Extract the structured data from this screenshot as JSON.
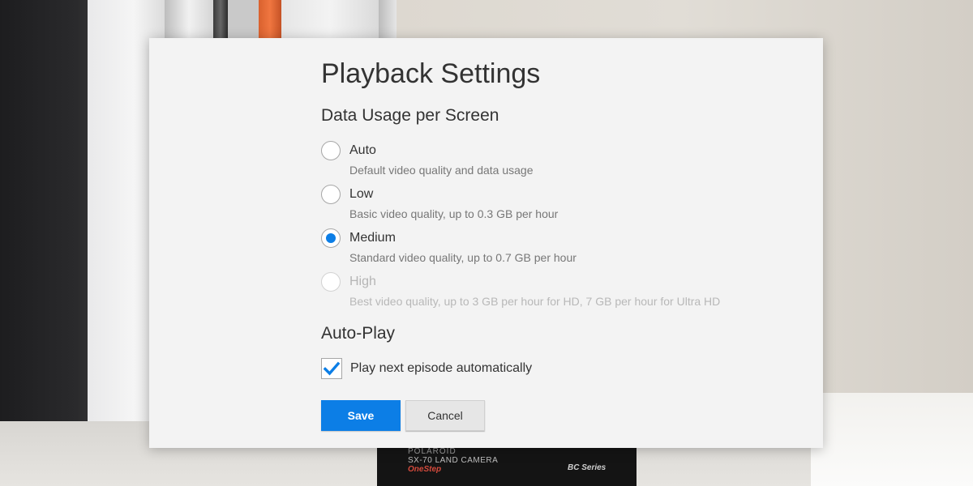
{
  "background": {
    "camera": {
      "line1": "POLAROID",
      "line2": "SX-70 LAND CAMERA",
      "line3": "OneStep",
      "line4": "BC Series"
    }
  },
  "dialog": {
    "title": "Playback Settings",
    "data_usage": {
      "heading": "Data Usage per Screen",
      "selected": "Medium",
      "options": [
        {
          "label": "Auto",
          "description": "Default video quality and data usage",
          "selected": false,
          "disabled": false
        },
        {
          "label": "Low",
          "description": "Basic video quality, up to 0.3 GB per hour",
          "selected": false,
          "disabled": false
        },
        {
          "label": "Medium",
          "description": "Standard video quality, up to 0.7 GB per hour",
          "selected": true,
          "disabled": false
        },
        {
          "label": "High",
          "description": "Best video quality, up to 3 GB per hour for HD, 7 GB per hour for Ultra HD",
          "selected": false,
          "disabled": true
        }
      ]
    },
    "autoplay": {
      "heading": "Auto-Play",
      "checkbox_label": "Play next episode automatically",
      "checked": true
    },
    "buttons": {
      "save_label": "Save",
      "cancel_label": "Cancel"
    }
  },
  "colors": {
    "accent": "#0c7ee6",
    "dialog_bg": "#f3f3f3",
    "text": "#333333",
    "muted_text": "#777777",
    "disabled_text": "#b5b5b5"
  }
}
